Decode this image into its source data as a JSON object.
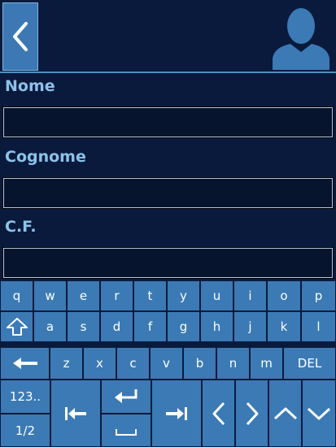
{
  "form": {
    "name_label": "Nome",
    "name_value": "",
    "surname_label": "Cognome",
    "surname_value": "",
    "cf_label": "C.F.",
    "cf_value": ""
  },
  "keyboard": {
    "row1": [
      "q",
      "w",
      "e",
      "r",
      "t",
      "y",
      "u",
      "i",
      "o",
      "p"
    ],
    "row2": [
      "a",
      "s",
      "d",
      "f",
      "g",
      "h",
      "j",
      "k",
      "l"
    ],
    "row3": [
      "z",
      "x",
      "c",
      "v",
      "b",
      "n",
      "m"
    ],
    "del_label": "DEL",
    "numbers_label": "123..",
    "page_label": "1/2"
  },
  "colors": {
    "background": "#0a1a3c",
    "key": "#3b7ab5",
    "label": "#8cc3ea"
  },
  "icons": [
    "chevron-left-icon",
    "user-avatar-icon",
    "shift-icon",
    "backspace-icon",
    "enter-icon",
    "space-icon",
    "tab-back-icon",
    "tab-forward-icon",
    "arrow-left-icon",
    "arrow-right-icon",
    "arrow-up-icon",
    "arrow-down-icon"
  ]
}
